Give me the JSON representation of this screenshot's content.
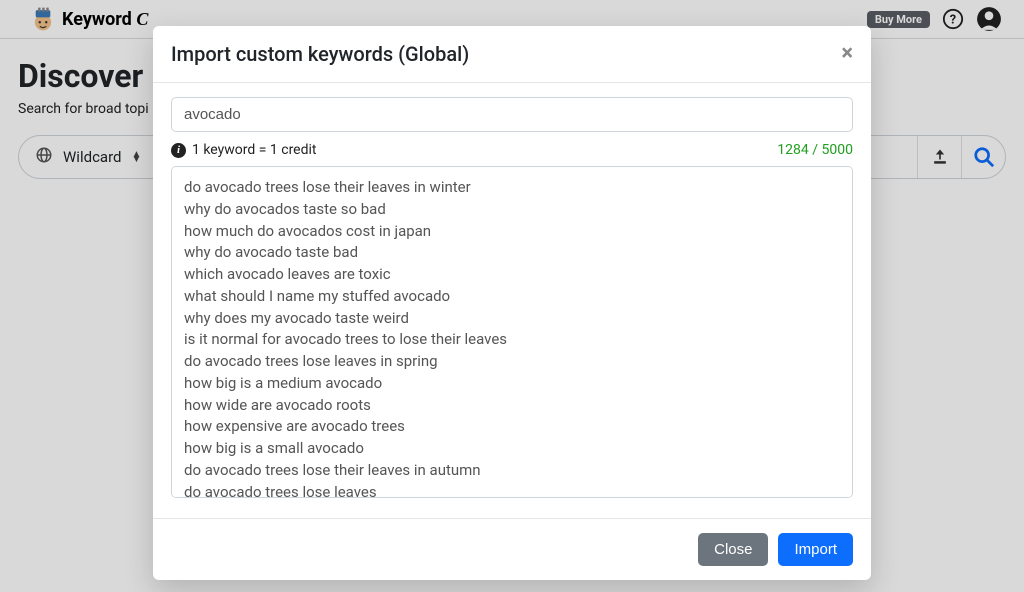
{
  "header": {
    "brand_name_bold": "Keyword",
    "brand_name_script": "C",
    "buy_more_label": "Buy More"
  },
  "page": {
    "title": "Discover",
    "subtitle": "Search for broad topi",
    "wildcard_label": "Wildcard"
  },
  "modal": {
    "title": "Import custom keywords (Global)",
    "search_value": "avocado",
    "credit_info": "1 keyword = 1 credit",
    "count_used": "1284",
    "count_sep": " / ",
    "count_max": "5000",
    "close_label": "Close",
    "import_label": "Import",
    "keywords": [
      "do avocado trees lose their leaves in winter",
      "why do avocados taste so bad",
      "how much do avocados cost in japan",
      "why do avocado taste bad",
      "which avocado leaves are toxic",
      "what should I name my stuffed avocado",
      "why does my avocado taste weird",
      "is it normal for avocado trees to lose their leaves",
      "do avocado trees lose leaves in spring",
      "how big is a medium avocado",
      "how wide are avocado roots",
      "how expensive are avocado trees",
      "how big is a small avocado",
      "do avocado trees lose their leaves in autumn",
      "do avocado trees lose leaves"
    ]
  }
}
